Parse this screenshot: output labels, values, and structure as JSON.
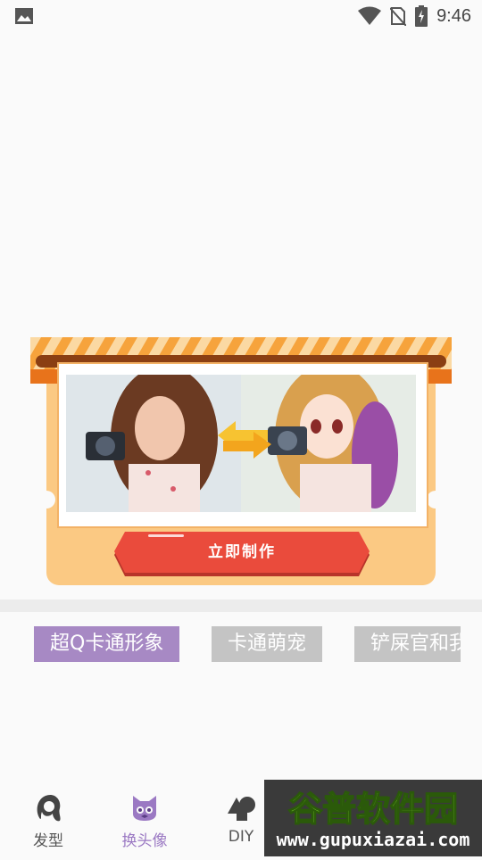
{
  "status_bar": {
    "time": "9:46",
    "icons": [
      "image-icon",
      "wifi-icon",
      "no-sim-icon",
      "battery-charging-icon"
    ]
  },
  "banner": {
    "make_button_label": "立即制作",
    "left_photo": "real-photo-girl-with-camera",
    "right_photo": "cartoon-version-girl-with-camera",
    "swap_icon": "swap-arrows-icon",
    "colors": {
      "awning_stripe": "#f08a1c",
      "card": "#fbc983",
      "button": "#ea4b3c"
    }
  },
  "tags": [
    {
      "label": "超Q卡通形象",
      "active": true
    },
    {
      "label": "卡通萌宠",
      "active": false
    },
    {
      "label": "铲屎官和我",
      "active": false
    }
  ],
  "nav": {
    "items": [
      {
        "label": "发型",
        "icon": "hair-icon",
        "active": false
      },
      {
        "label": "换头像",
        "icon": "cat-face-icon",
        "active": true
      },
      {
        "label": "DIY",
        "icon": "shapes-icon",
        "active": false
      }
    ],
    "accent": "#9b79c3"
  },
  "watermark": {
    "title": "谷普软件园",
    "url": "www.gupuxiazai.com"
  }
}
